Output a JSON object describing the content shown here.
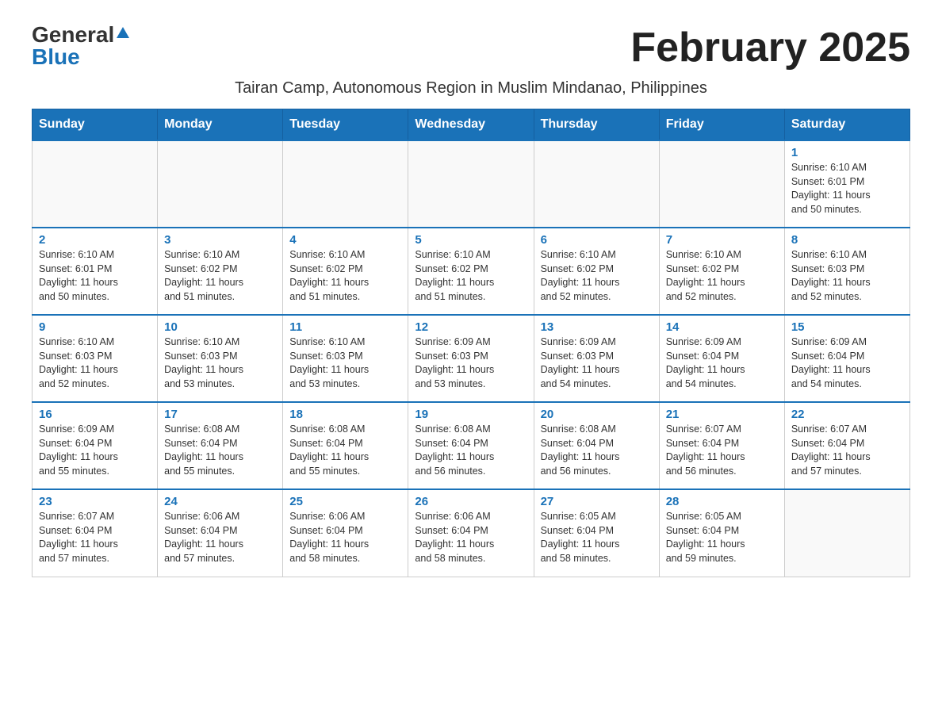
{
  "header": {
    "logo_general": "General",
    "logo_blue": "Blue",
    "month_title": "February 2025",
    "subtitle": "Tairan Camp, Autonomous Region in Muslim Mindanao, Philippines"
  },
  "days_of_week": [
    "Sunday",
    "Monday",
    "Tuesday",
    "Wednesday",
    "Thursday",
    "Friday",
    "Saturday"
  ],
  "weeks": [
    {
      "days": [
        {
          "number": "",
          "info": ""
        },
        {
          "number": "",
          "info": ""
        },
        {
          "number": "",
          "info": ""
        },
        {
          "number": "",
          "info": ""
        },
        {
          "number": "",
          "info": ""
        },
        {
          "number": "",
          "info": ""
        },
        {
          "number": "1",
          "info": "Sunrise: 6:10 AM\nSunset: 6:01 PM\nDaylight: 11 hours\nand 50 minutes."
        }
      ]
    },
    {
      "days": [
        {
          "number": "2",
          "info": "Sunrise: 6:10 AM\nSunset: 6:01 PM\nDaylight: 11 hours\nand 50 minutes."
        },
        {
          "number": "3",
          "info": "Sunrise: 6:10 AM\nSunset: 6:02 PM\nDaylight: 11 hours\nand 51 minutes."
        },
        {
          "number": "4",
          "info": "Sunrise: 6:10 AM\nSunset: 6:02 PM\nDaylight: 11 hours\nand 51 minutes."
        },
        {
          "number": "5",
          "info": "Sunrise: 6:10 AM\nSunset: 6:02 PM\nDaylight: 11 hours\nand 51 minutes."
        },
        {
          "number": "6",
          "info": "Sunrise: 6:10 AM\nSunset: 6:02 PM\nDaylight: 11 hours\nand 52 minutes."
        },
        {
          "number": "7",
          "info": "Sunrise: 6:10 AM\nSunset: 6:02 PM\nDaylight: 11 hours\nand 52 minutes."
        },
        {
          "number": "8",
          "info": "Sunrise: 6:10 AM\nSunset: 6:03 PM\nDaylight: 11 hours\nand 52 minutes."
        }
      ]
    },
    {
      "days": [
        {
          "number": "9",
          "info": "Sunrise: 6:10 AM\nSunset: 6:03 PM\nDaylight: 11 hours\nand 52 minutes."
        },
        {
          "number": "10",
          "info": "Sunrise: 6:10 AM\nSunset: 6:03 PM\nDaylight: 11 hours\nand 53 minutes."
        },
        {
          "number": "11",
          "info": "Sunrise: 6:10 AM\nSunset: 6:03 PM\nDaylight: 11 hours\nand 53 minutes."
        },
        {
          "number": "12",
          "info": "Sunrise: 6:09 AM\nSunset: 6:03 PM\nDaylight: 11 hours\nand 53 minutes."
        },
        {
          "number": "13",
          "info": "Sunrise: 6:09 AM\nSunset: 6:03 PM\nDaylight: 11 hours\nand 54 minutes."
        },
        {
          "number": "14",
          "info": "Sunrise: 6:09 AM\nSunset: 6:04 PM\nDaylight: 11 hours\nand 54 minutes."
        },
        {
          "number": "15",
          "info": "Sunrise: 6:09 AM\nSunset: 6:04 PM\nDaylight: 11 hours\nand 54 minutes."
        }
      ]
    },
    {
      "days": [
        {
          "number": "16",
          "info": "Sunrise: 6:09 AM\nSunset: 6:04 PM\nDaylight: 11 hours\nand 55 minutes."
        },
        {
          "number": "17",
          "info": "Sunrise: 6:08 AM\nSunset: 6:04 PM\nDaylight: 11 hours\nand 55 minutes."
        },
        {
          "number": "18",
          "info": "Sunrise: 6:08 AM\nSunset: 6:04 PM\nDaylight: 11 hours\nand 55 minutes."
        },
        {
          "number": "19",
          "info": "Sunrise: 6:08 AM\nSunset: 6:04 PM\nDaylight: 11 hours\nand 56 minutes."
        },
        {
          "number": "20",
          "info": "Sunrise: 6:08 AM\nSunset: 6:04 PM\nDaylight: 11 hours\nand 56 minutes."
        },
        {
          "number": "21",
          "info": "Sunrise: 6:07 AM\nSunset: 6:04 PM\nDaylight: 11 hours\nand 56 minutes."
        },
        {
          "number": "22",
          "info": "Sunrise: 6:07 AM\nSunset: 6:04 PM\nDaylight: 11 hours\nand 57 minutes."
        }
      ]
    },
    {
      "days": [
        {
          "number": "23",
          "info": "Sunrise: 6:07 AM\nSunset: 6:04 PM\nDaylight: 11 hours\nand 57 minutes."
        },
        {
          "number": "24",
          "info": "Sunrise: 6:06 AM\nSunset: 6:04 PM\nDaylight: 11 hours\nand 57 minutes."
        },
        {
          "number": "25",
          "info": "Sunrise: 6:06 AM\nSunset: 6:04 PM\nDaylight: 11 hours\nand 58 minutes."
        },
        {
          "number": "26",
          "info": "Sunrise: 6:06 AM\nSunset: 6:04 PM\nDaylight: 11 hours\nand 58 minutes."
        },
        {
          "number": "27",
          "info": "Sunrise: 6:05 AM\nSunset: 6:04 PM\nDaylight: 11 hours\nand 58 minutes."
        },
        {
          "number": "28",
          "info": "Sunrise: 6:05 AM\nSunset: 6:04 PM\nDaylight: 11 hours\nand 59 minutes."
        },
        {
          "number": "",
          "info": ""
        }
      ]
    }
  ]
}
